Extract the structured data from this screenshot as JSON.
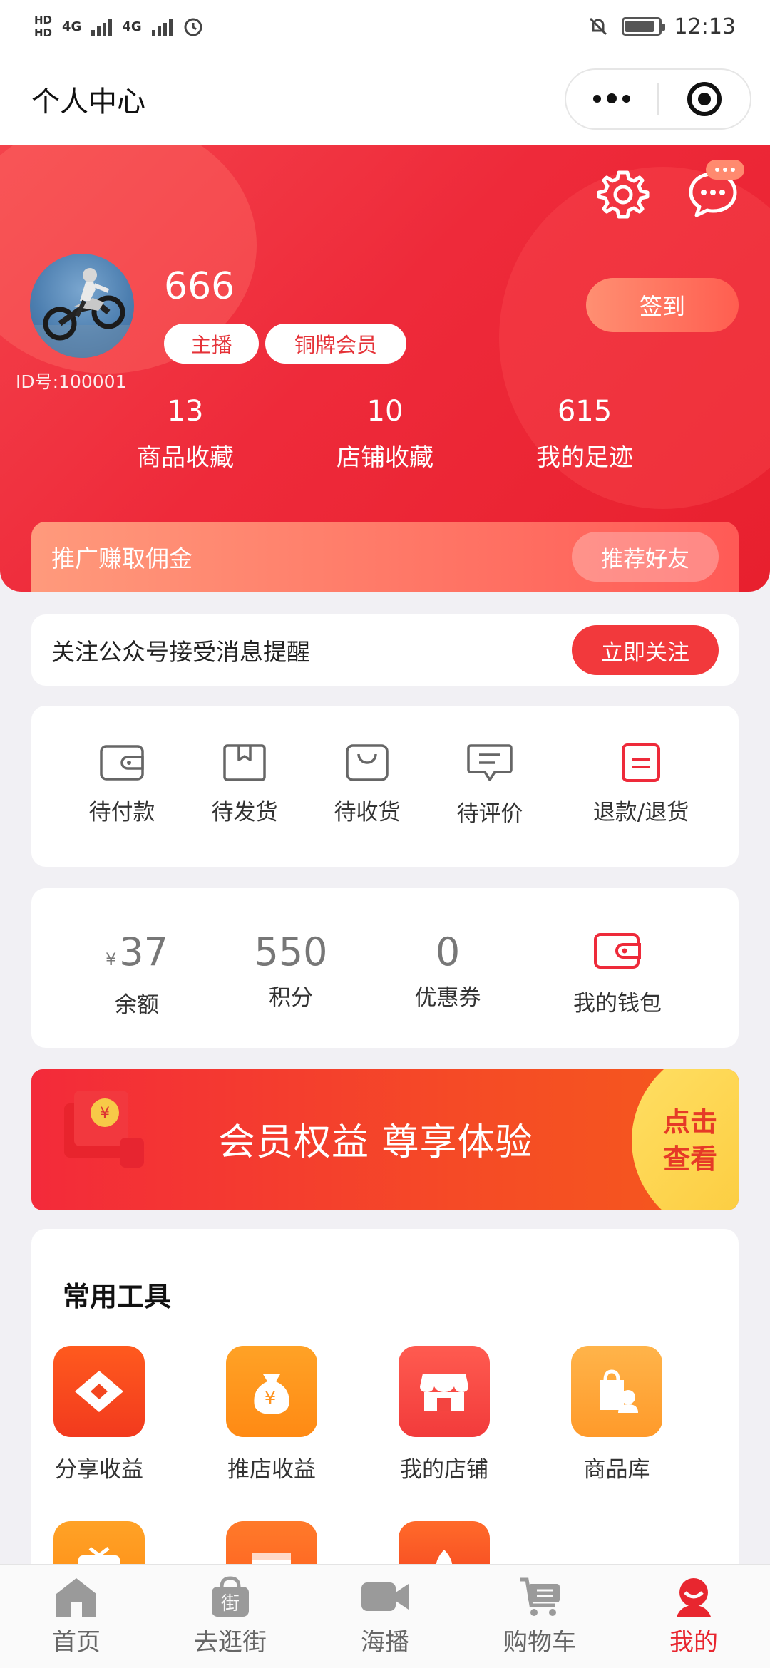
{
  "status_bar": {
    "time": "12:13",
    "net1": "4G",
    "net2": "4G",
    "hd1": "HD",
    "hd2": "HD"
  },
  "nav": {
    "title": "个人中心"
  },
  "profile": {
    "username": "666",
    "id_text": "ID号:100001",
    "tags": [
      "主播",
      "铜牌会员"
    ],
    "checkin_label": "签到",
    "stats": [
      {
        "value": "13",
        "label": "商品收藏"
      },
      {
        "value": "10",
        "label": "店铺收藏"
      },
      {
        "value": "615",
        "label": "我的足迹"
      }
    ]
  },
  "promo": {
    "text": "推广赚取佣金",
    "button": "推荐好友"
  },
  "follow": {
    "text": "关注公众号接受消息提醒",
    "button": "立即关注"
  },
  "orders": [
    {
      "label": "待付款",
      "icon": "wallet-icon"
    },
    {
      "label": "待发货",
      "icon": "box-icon"
    },
    {
      "label": "待收货",
      "icon": "bag-icon"
    },
    {
      "label": "待评价",
      "icon": "comment-icon"
    },
    {
      "label": "退款/退货",
      "icon": "refund-icon"
    }
  ],
  "wallet": {
    "currency": "¥",
    "balance": "37",
    "balance_label": "余额",
    "points": "550",
    "points_label": "积分",
    "coupons": "0",
    "coupons_label": "优惠券",
    "wallet_label": "我的钱包"
  },
  "banner": {
    "text": "会员权益 尊享体验",
    "cta": "点击查看"
  },
  "tools": {
    "title": "常用工具",
    "items": [
      {
        "label": "分享收益",
        "icon": "share-earnings-icon"
      },
      {
        "label": "推店收益",
        "icon": "money-bag-icon"
      },
      {
        "label": "我的店铺",
        "icon": "store-icon"
      },
      {
        "label": "商品库",
        "icon": "product-library-icon"
      }
    ],
    "row2_icons": [
      "tv-icon",
      "video-icon",
      "tool-icon"
    ]
  },
  "tabbar": [
    {
      "label": "首页",
      "icon": "home-icon"
    },
    {
      "label": "去逛街",
      "icon": "street-bag-icon",
      "glyph": "街"
    },
    {
      "label": "海播",
      "icon": "camera-icon"
    },
    {
      "label": "购物车",
      "icon": "cart-icon"
    },
    {
      "label": "我的",
      "icon": "profile-icon",
      "active": true
    }
  ],
  "colors": {
    "brand_red": "#ee2a3a",
    "accent_orange": "#ff7d6a",
    "active_tab": "#e8262f"
  }
}
